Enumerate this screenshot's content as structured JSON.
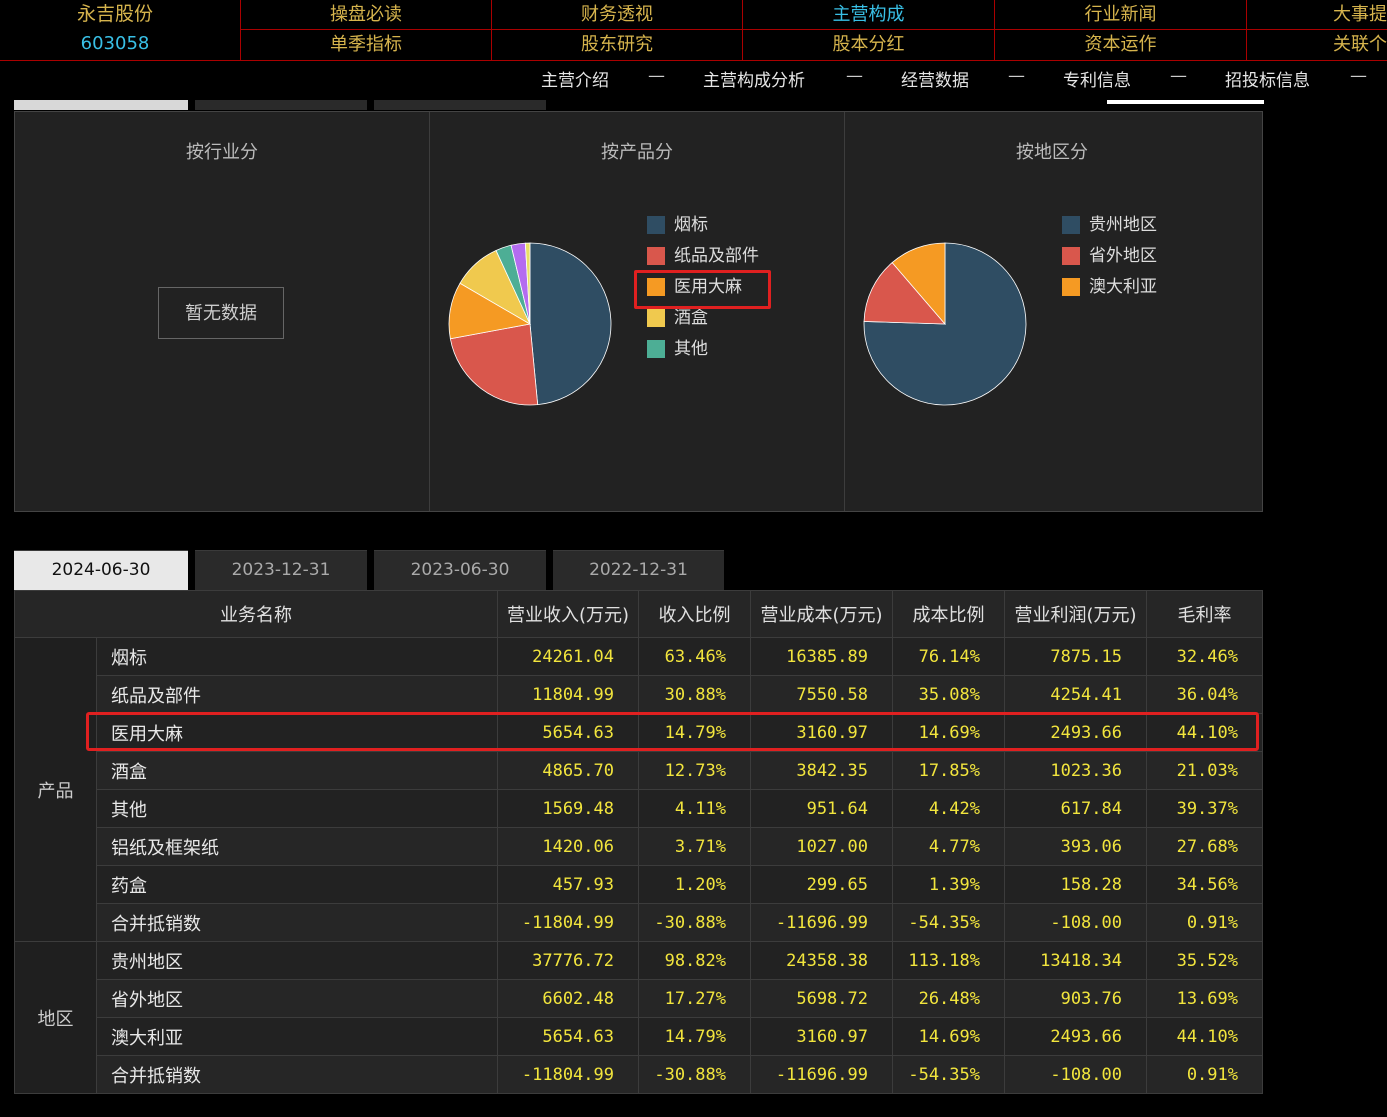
{
  "stock": {
    "name": "永吉股份",
    "code": "603058"
  },
  "nav_top": [
    "操盘必读",
    "财务透视",
    "主营构成",
    "行业新闻",
    "大事提"
  ],
  "nav_bottom": [
    "单季指标",
    "股东研究",
    "股本分红",
    "资本运作",
    "关联个"
  ],
  "nav_active": "主营构成",
  "subnav": [
    "主营介绍",
    "主营构成分析",
    "经营数据",
    "专利信息",
    "招投标信息"
  ],
  "subnav_sep": "—",
  "panels": {
    "industry": {
      "title": "按行业分",
      "empty_label": "暂无数据"
    },
    "product": {
      "title": "按产品分",
      "legend": [
        "烟标",
        "纸品及部件",
        "医用大麻",
        "酒盒",
        "其他"
      ],
      "highlighted": "医用大麻"
    },
    "region": {
      "title": "按地区分",
      "legend": [
        "贵州地区",
        "省外地区",
        "澳大利亚"
      ]
    }
  },
  "chart_data": [
    {
      "type": "pie",
      "title": "按产品分",
      "labels": [
        "烟标",
        "纸品及部件",
        "医用大麻",
        "酒盒",
        "其他",
        "铝纸及框架纸",
        "药盒"
      ],
      "values": [
        24261.04,
        11804.99,
        5654.63,
        4865.7,
        1569.48,
        1420.06,
        457.93
      ],
      "colors": [
        "#2f4d63",
        "#d9574c",
        "#f59a23",
        "#f0c94e",
        "#4dae95",
        "#b46cf0",
        "#e8e066"
      ]
    },
    {
      "type": "pie",
      "title": "按地区分",
      "labels": [
        "贵州地区",
        "省外地区",
        "澳大利亚"
      ],
      "values": [
        37776.72,
        6602.48,
        5654.63
      ],
      "colors": [
        "#2f4d63",
        "#d9574c",
        "#f59a23"
      ]
    }
  ],
  "tabs": [
    "2024-06-30",
    "2023-12-31",
    "2023-06-30",
    "2022-12-31"
  ],
  "active_tab": "2024-06-30",
  "table": {
    "headers": [
      "业务名称",
      "营业收入(万元)",
      "收入比例",
      "营业成本(万元)",
      "成本比例",
      "营业利润(万元)",
      "毛利率"
    ],
    "groups": [
      {
        "label": "产品",
        "rows": [
          [
            "烟标",
            "24261.04",
            "63.46%",
            "16385.89",
            "76.14%",
            "7875.15",
            "32.46%"
          ],
          [
            "纸品及部件",
            "11804.99",
            "30.88%",
            "7550.58",
            "35.08%",
            "4254.41",
            "36.04%"
          ],
          [
            "医用大麻",
            "5654.63",
            "14.79%",
            "3160.97",
            "14.69%",
            "2493.66",
            "44.10%"
          ],
          [
            "酒盒",
            "4865.70",
            "12.73%",
            "3842.35",
            "17.85%",
            "1023.36",
            "21.03%"
          ],
          [
            "其他",
            "1569.48",
            "4.11%",
            "951.64",
            "4.42%",
            "617.84",
            "39.37%"
          ],
          [
            "铝纸及框架纸",
            "1420.06",
            "3.71%",
            "1027.00",
            "4.77%",
            "393.06",
            "27.68%"
          ],
          [
            "药盒",
            "457.93",
            "1.20%",
            "299.65",
            "1.39%",
            "158.28",
            "34.56%"
          ],
          [
            "合并抵销数",
            "-11804.99",
            "-30.88%",
            "-11696.99",
            "-54.35%",
            "-108.00",
            "0.91%"
          ]
        ]
      },
      {
        "label": "地区",
        "rows": [
          [
            "贵州地区",
            "37776.72",
            "98.82%",
            "24358.38",
            "113.18%",
            "13418.34",
            "35.52%"
          ],
          [
            "省外地区",
            "6602.48",
            "17.27%",
            "5698.72",
            "26.48%",
            "903.76",
            "13.69%"
          ],
          [
            "澳大利亚",
            "5654.63",
            "14.79%",
            "3160.97",
            "14.69%",
            "2493.66",
            "44.10%"
          ],
          [
            "合并抵销数",
            "-11804.99",
            "-30.88%",
            "-11696.99",
            "-54.35%",
            "-108.00",
            "0.91%"
          ]
        ]
      }
    ]
  }
}
